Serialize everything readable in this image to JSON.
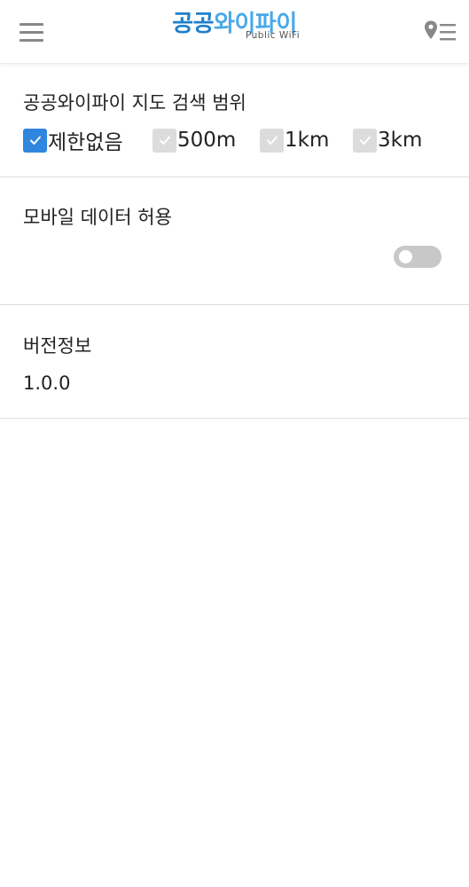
{
  "header": {
    "logo_part1": "공공",
    "logo_part2": "와이파이",
    "logo_sub": "Public WiFi"
  },
  "search_range": {
    "title": "공공와이파이 지도 검색 범위",
    "options": [
      {
        "label": "제한없음",
        "checked": true
      },
      {
        "label": "500m",
        "checked": false
      },
      {
        "label": "1km",
        "checked": false
      },
      {
        "label": "3km",
        "checked": false
      }
    ]
  },
  "mobile_data": {
    "title": "모바일 데이터 허용",
    "enabled": false
  },
  "version_info": {
    "title": "버전정보",
    "value": "1.0.0"
  },
  "colors": {
    "brand_dark": "#1f7fc9",
    "brand_light": "#4aa8e8",
    "checkbox_on": "#2e86de",
    "checkbox_off": "#dcdcdc",
    "toggle_off": "#c8c8c8"
  }
}
